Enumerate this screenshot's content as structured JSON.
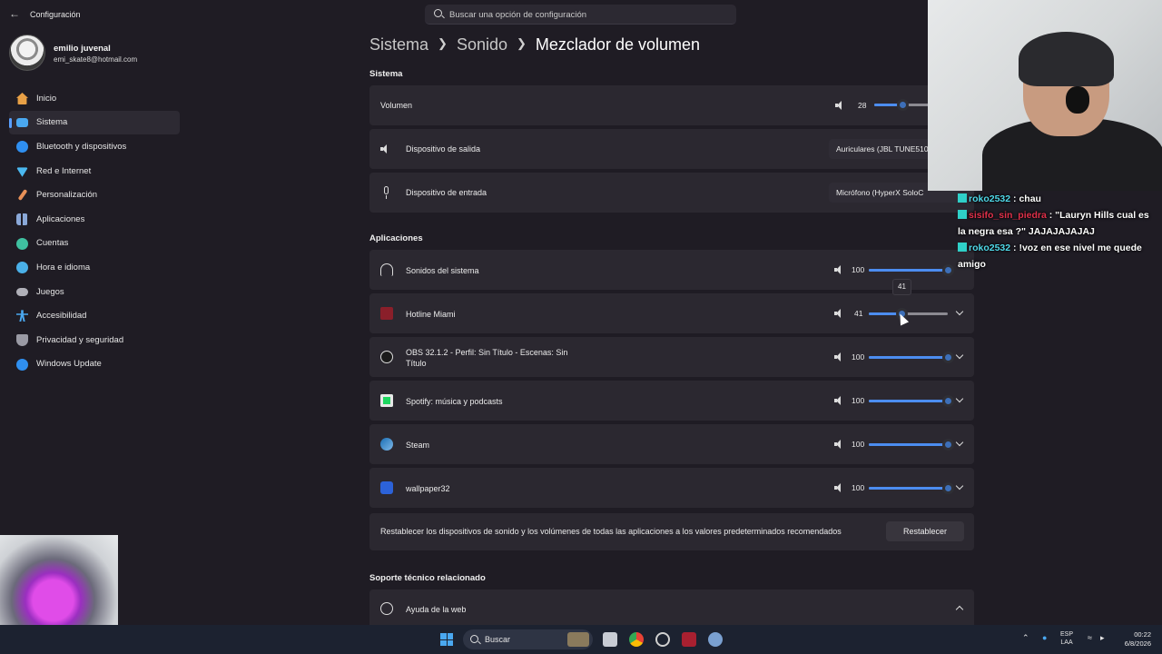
{
  "window": {
    "title": "Configuración"
  },
  "search": {
    "placeholder": "Buscar una opción de configuración"
  },
  "profile": {
    "name": "emilio juvenal",
    "email": "emi_skate8@hotmail.com"
  },
  "sidebar": {
    "items": [
      {
        "label": "Inicio",
        "icon": "home-icon",
        "color": "#e8a046"
      },
      {
        "label": "Sistema",
        "icon": "monitor-icon",
        "color": "#4aa8f0",
        "active": true
      },
      {
        "label": "Bluetooth y dispositivos",
        "icon": "bluetooth-icon",
        "color": "#2f8ff0"
      },
      {
        "label": "Red e Internet",
        "icon": "wifi-icon",
        "color": "#4ab8f0"
      },
      {
        "label": "Personalización",
        "icon": "brush-icon",
        "color": "#e89058"
      },
      {
        "label": "Aplicaciones",
        "icon": "apps-icon",
        "color": "#8aa8d8"
      },
      {
        "label": "Cuentas",
        "icon": "person-icon",
        "color": "#3fc0a0"
      },
      {
        "label": "Hora e idioma",
        "icon": "globe-clock-icon",
        "color": "#4ab0e8"
      },
      {
        "label": "Juegos",
        "icon": "gamepad-icon",
        "color": "#b0b0b8"
      },
      {
        "label": "Accesibilidad",
        "icon": "accessibility-icon",
        "color": "#4aa8f0"
      },
      {
        "label": "Privacidad y seguridad",
        "icon": "shield-icon",
        "color": "#9a9aa4"
      },
      {
        "label": "Windows Update",
        "icon": "update-icon",
        "color": "#2f8ff0"
      }
    ]
  },
  "breadcrumb": {
    "part1": "Sistema",
    "part2": "Sonido",
    "current": "Mezclador de volumen"
  },
  "system": {
    "heading": "Sistema",
    "volume": {
      "label": "Volumen",
      "value": "28",
      "level": 0.28
    },
    "output": {
      "label": "Dispositivo de salida",
      "value": "Auriculares (JBL TUNE510"
    },
    "input": {
      "label": "Dispositivo de entrada",
      "value": "Micrófono (HyperX SoloC"
    }
  },
  "apps": {
    "heading": "Aplicaciones",
    "items": [
      {
        "label": "Sonidos del sistema",
        "value": "100",
        "level": 1.0,
        "icon": "headphones-icon",
        "expand": false
      },
      {
        "label": "Hotline Miami",
        "value": "41",
        "level": 0.41,
        "icon": "hotline-miami-icon",
        "expand": true
      },
      {
        "label": "OBS 32.1.2 - Perfil: Sin Título - Escenas: Sin Título",
        "value": "100",
        "level": 1.0,
        "icon": "obs-icon",
        "expand": true
      },
      {
        "label": "Spotify: música y podcasts",
        "value": "100",
        "level": 1.0,
        "icon": "spotify-icon",
        "expand": true
      },
      {
        "label": "Steam",
        "value": "100",
        "level": 1.0,
        "icon": "steam-icon",
        "expand": true
      },
      {
        "label": "wallpaper32",
        "value": "100",
        "level": 1.0,
        "icon": "wallpaper-engine-icon",
        "expand": true
      }
    ],
    "tooltip": "41"
  },
  "reset": {
    "text": "Restablecer los dispositivos de sonido y los volúmenes de todas las aplicaciones a los valores predeterminados recomendados",
    "button": "Restablecer"
  },
  "support": {
    "heading": "Soporte técnico relacionado",
    "web_help": "Ayuda de la web"
  },
  "chat": {
    "messages": [
      {
        "user": "roko2532",
        "text": ": chau"
      },
      {
        "user": "sisifo_sin_piedra",
        "text": ": \"Lauryn Hills cual es la negra esa ?\" JAJAJAJAJAJ"
      },
      {
        "user": "roko2532",
        "text": ": !voz en ese nivel me quede amigo"
      }
    ]
  },
  "taskbar": {
    "search": "Buscar",
    "lang1": "ESP",
    "lang2": "LAA",
    "time": "00:22",
    "date": "6/8/2026"
  },
  "colors": {
    "accent": "#4c8df0",
    "background": "#1f1c24",
    "card": "#2b2830"
  }
}
